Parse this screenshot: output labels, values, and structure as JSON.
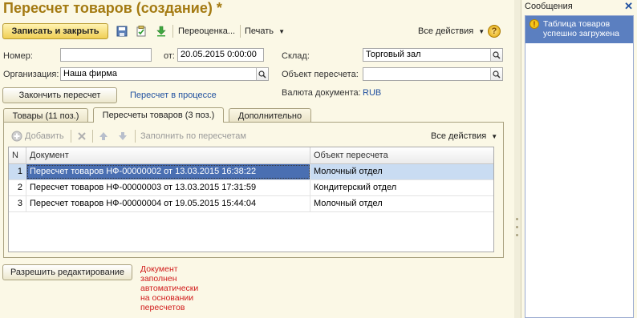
{
  "window": {
    "title": "Пересчет товаров (создание) *"
  },
  "toolbar": {
    "save_close": "Записать и закрыть",
    "reprice": "Переоценка...",
    "print": "Печать",
    "all_actions": "Все действия",
    "help": "?"
  },
  "form": {
    "number_label": "Номер:",
    "number_value": "",
    "from_label": "от:",
    "date_value": "20.05.2015  0:00:00",
    "warehouse_label": "Склад:",
    "warehouse_value": "Торговый зал",
    "org_label": "Организация:",
    "org_value": "Наша фирма",
    "recount_object_label": "Объект пересчета:",
    "recount_object_value": "",
    "finish_button": "Закончить пересчет",
    "status_link": "Пересчет в процессе",
    "currency_label": "Валюта документа:",
    "currency_value": "RUB"
  },
  "tabs": [
    {
      "label": "Товары (11 поз.)"
    },
    {
      "label": "Пересчеты товаров (3 поз.)"
    },
    {
      "label": "Дополнительно"
    }
  ],
  "tab_toolbar": {
    "add": "Добавить",
    "fill": "Заполнить по пересчетам",
    "all_actions": "Все действия"
  },
  "table": {
    "columns": [
      "N",
      "Документ",
      "Объект пересчета"
    ],
    "rows": [
      {
        "n": "1",
        "doc": "Пересчет товаров НФ-00000002 от 13.03.2015 16:38:22",
        "object": "Молочный отдел"
      },
      {
        "n": "2",
        "doc": "Пересчет товаров НФ-00000003 от 13.03.2015 17:31:59",
        "object": "Кондитерский отдел"
      },
      {
        "n": "3",
        "doc": "Пересчет товаров НФ-00000004 от 19.05.2015 15:44:04",
        "object": "Молочный отдел"
      }
    ]
  },
  "footer": {
    "allow_edit": "Разрешить редактирование",
    "note_lines": [
      "Документ",
      "заполнен",
      "автоматически",
      "на основании",
      "пересчетов"
    ]
  },
  "messages": {
    "title": "Сообщения",
    "items": [
      {
        "line1": "Таблица товаров",
        "line2": "успешно загружена"
      }
    ]
  },
  "colors": {
    "title": "#a47a12",
    "background": "#fbf8e6",
    "selection": "#4a6fb2",
    "message_highlight": "#5b7fc0",
    "note": "#d11a1a",
    "link": "#1f4f9f"
  }
}
